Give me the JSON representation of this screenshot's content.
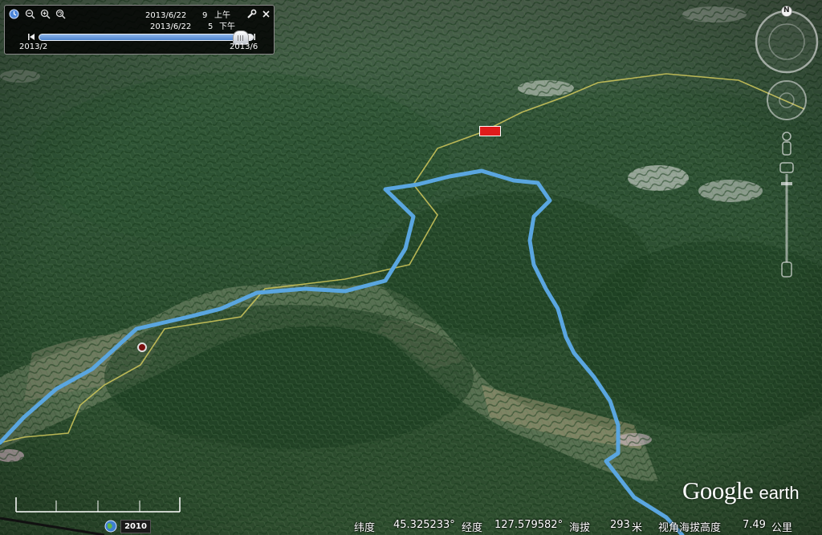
{
  "time_slider": {
    "begin_date": "2013/6/22",
    "begin_hour": "9",
    "begin_period": "上午",
    "end_date": "2013/6/22",
    "end_hour": "5",
    "end_period": "下午",
    "range_start": "2013/2",
    "range_end": "2013/6",
    "position_fraction": 0.94
  },
  "compass": {
    "north_label": "N"
  },
  "map": {
    "track_color": "#5aa6e0",
    "boundary_color": "#c9c25a",
    "placemark_color": "#e01b1b"
  },
  "imagery_year": "2010",
  "status": {
    "lat_label": "纬度",
    "lat_value": "45.325233°",
    "lon_label": "经度",
    "lon_value": "127.579582°",
    "elev_label": "海拔",
    "elev_value": "293",
    "elev_unit": "米",
    "eye_label": "视角海拔高度",
    "eye_value": "7.49",
    "eye_unit": "公里"
  },
  "brand": {
    "google": "Google",
    "earth": "earth"
  }
}
